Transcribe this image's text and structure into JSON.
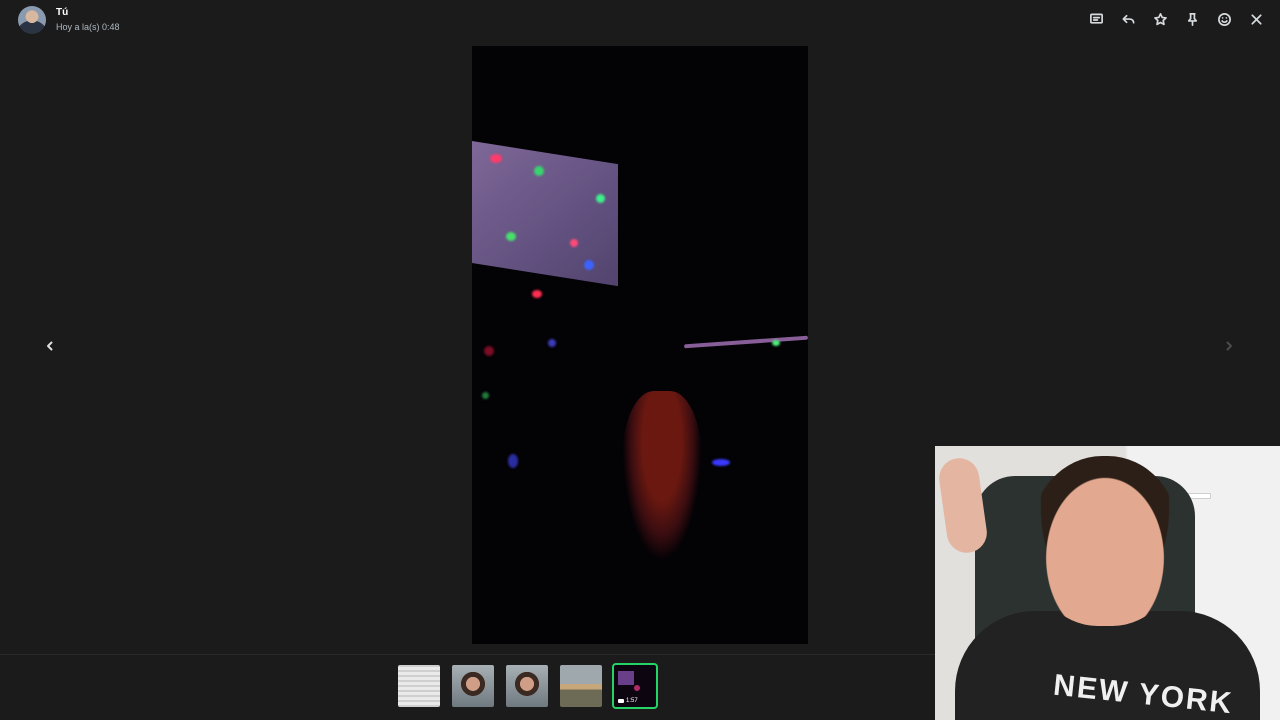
{
  "header": {
    "sender": "Tú",
    "timestamp": "Hoy a la(s) 0:48"
  },
  "toolbar": {
    "icons": [
      "message-icon",
      "reply-icon",
      "star-icon",
      "pin-icon",
      "emoji-icon",
      "close-icon"
    ]
  },
  "thumbnails": [
    {
      "kind": "document"
    },
    {
      "kind": "photo"
    },
    {
      "kind": "photo"
    },
    {
      "kind": "photo"
    },
    {
      "kind": "video",
      "duration": "1:57",
      "selected": true
    }
  ],
  "webcam": {
    "shirt_text": "NEW YORK"
  },
  "colors": {
    "background": "#1b1b1b",
    "accent": "#25d366"
  }
}
